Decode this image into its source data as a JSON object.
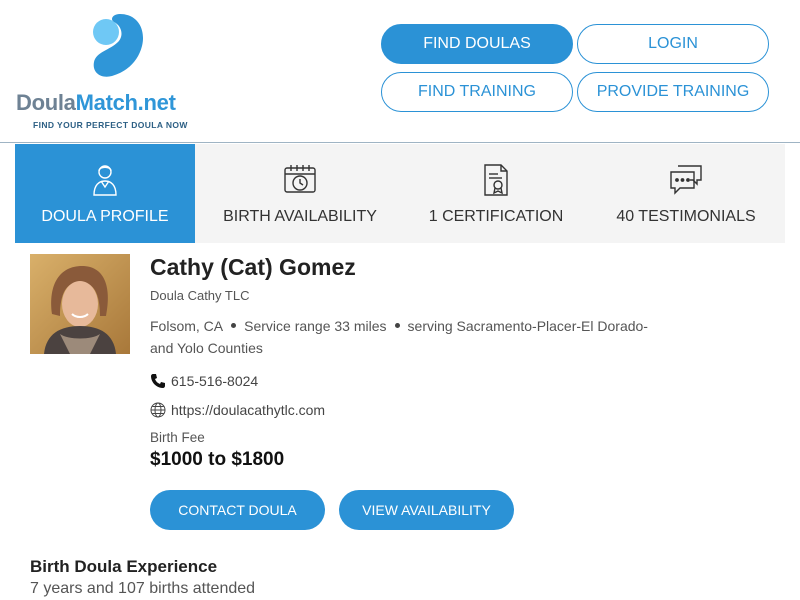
{
  "brand": {
    "name_part1": "Doula",
    "name_part2": "Match.net",
    "tagline": "FIND YOUR PERFECT DOULA NOW"
  },
  "nav": {
    "find_doulas": "FIND DOULAS",
    "login": "LOGIN",
    "find_training": "FIND TRAINING",
    "provide_training": "PROVIDE TRAINING"
  },
  "tabs": [
    {
      "label": "DOULA PROFILE",
      "icon": "doula-person-icon",
      "active": true
    },
    {
      "label": "BIRTH AVAILABILITY",
      "icon": "calendar-clock-icon",
      "active": false
    },
    {
      "label": "1 CERTIFICATION",
      "icon": "certificate-icon",
      "active": false
    },
    {
      "label": "40 TESTIMONIALS",
      "icon": "chat-bubbles-icon",
      "active": false
    }
  ],
  "profile": {
    "name": "Cathy (Cat) Gomez",
    "business": "Doula Cathy TLC",
    "city": "Folsom, CA",
    "service_range": "Service range 33 miles",
    "serving": "serving Sacramento-Placer-El Dorado-and Yolo Counties",
    "phone": "615-516-8024",
    "website": "https://doulacathytlc.com",
    "fee_label": "Birth Fee",
    "fee_value": "$1000 to $1800"
  },
  "actions": {
    "contact": "CONTACT DOULA",
    "availability": "VIEW AVAILABILITY"
  },
  "experience": {
    "title": "Birth Doula Experience",
    "text": "7 years and 107 births attended"
  },
  "colors": {
    "accent": "#2b92d6",
    "tab_bg": "#f4f4f4",
    "logo_gray": "#6e8294",
    "logo_blue": "#2f96d8",
    "logo_light_blue": "#5cc0f2"
  }
}
